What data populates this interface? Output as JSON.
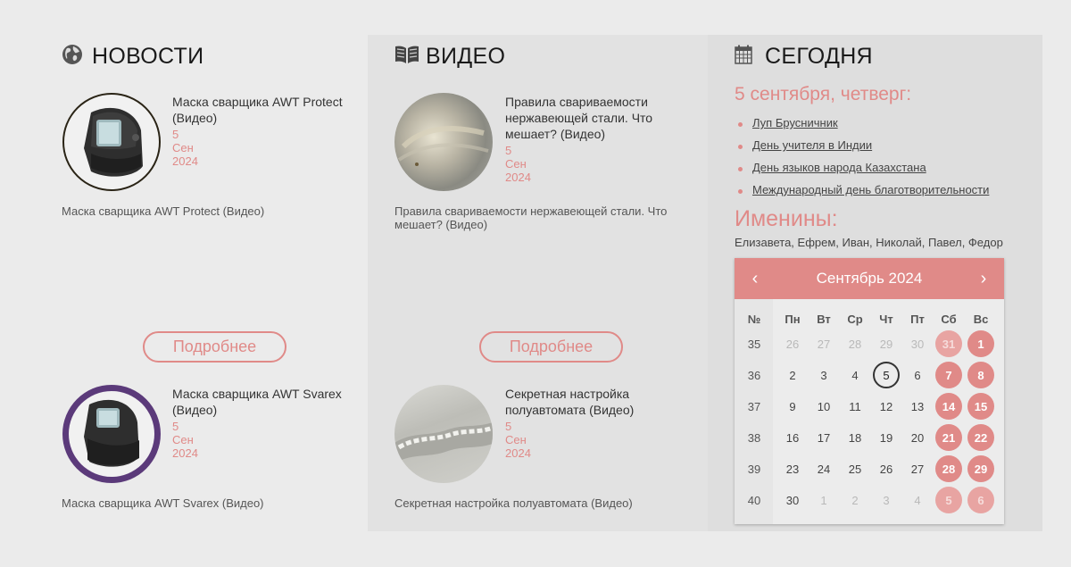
{
  "news": {
    "title": "НОВОСТИ",
    "icon": "globe-icon",
    "items": [
      {
        "title": "Маска сварщика AWT Protect (Видео)",
        "date": "5 Сен 2024",
        "desc": "Маска сварщика AWT Protect (Видео)"
      },
      {
        "title": "Маска сварщика AWT Svarex (Видео)",
        "date": "5 Сен 2024",
        "desc": "Маска сварщика AWT Svarex (Видео)"
      }
    ],
    "more_label": "Подробнее"
  },
  "video": {
    "title": "ВИДЕО",
    "icon": "book-icon",
    "items": [
      {
        "title": "Правила свариваемости нержавеющей стали. Что мешает? (Видео)",
        "date": "5 Сен 2024",
        "desc": "Правила свариваемости нержавеющей стали. Что мешает? (Видео)"
      },
      {
        "title": "Секретная настройка полуавтомата (Видео)",
        "date": "5 Сен 2024",
        "desc": "Секретная настройка полуавтомата (Видео)"
      }
    ],
    "more_label": "Подробнее"
  },
  "today": {
    "title": "СЕГОДНЯ",
    "icon": "calendar-icon",
    "date_text": "5 сентября, четверг:",
    "events": [
      "Луп Брусничник",
      "День учителя в Индии",
      "День языков народа Казахстана",
      "Международный день благотворительности"
    ],
    "namedays_title": "Именины:",
    "namedays": "Елизавета, Ефрем, Иван, Николай, Павел, Федор"
  },
  "calendar": {
    "month_label": "Сентябрь 2024",
    "prev": "‹",
    "next": "›",
    "week_header": "№",
    "weekdays": [
      "Пн",
      "Вт",
      "Ср",
      "Чт",
      "Пт",
      "Сб",
      "Вс"
    ],
    "weeks": [
      {
        "num": "35",
        "days": [
          {
            "d": "26",
            "m": true
          },
          {
            "d": "27",
            "m": true
          },
          {
            "d": "28",
            "m": true
          },
          {
            "d": "29",
            "m": true
          },
          {
            "d": "30",
            "m": true
          },
          {
            "d": "31",
            "m": true
          },
          {
            "d": "1",
            "m": false
          }
        ]
      },
      {
        "num": "36",
        "days": [
          {
            "d": "2",
            "m": false
          },
          {
            "d": "3",
            "m": false
          },
          {
            "d": "4",
            "m": false
          },
          {
            "d": "5",
            "m": false,
            "today": true
          },
          {
            "d": "6",
            "m": false
          },
          {
            "d": "7",
            "m": false
          },
          {
            "d": "8",
            "m": false
          }
        ]
      },
      {
        "num": "37",
        "days": [
          {
            "d": "9",
            "m": false
          },
          {
            "d": "10",
            "m": false
          },
          {
            "d": "11",
            "m": false
          },
          {
            "d": "12",
            "m": false
          },
          {
            "d": "13",
            "m": false
          },
          {
            "d": "14",
            "m": false
          },
          {
            "d": "15",
            "m": false
          }
        ]
      },
      {
        "num": "38",
        "days": [
          {
            "d": "16",
            "m": false
          },
          {
            "d": "17",
            "m": false
          },
          {
            "d": "18",
            "m": false
          },
          {
            "d": "19",
            "m": false
          },
          {
            "d": "20",
            "m": false
          },
          {
            "d": "21",
            "m": false
          },
          {
            "d": "22",
            "m": false
          }
        ]
      },
      {
        "num": "39",
        "days": [
          {
            "d": "23",
            "m": false
          },
          {
            "d": "24",
            "m": false
          },
          {
            "d": "25",
            "m": false
          },
          {
            "d": "26",
            "m": false
          },
          {
            "d": "27",
            "m": false
          },
          {
            "d": "28",
            "m": false
          },
          {
            "d": "29",
            "m": false
          }
        ]
      },
      {
        "num": "40",
        "days": [
          {
            "d": "30",
            "m": false
          },
          {
            "d": "1",
            "m": true
          },
          {
            "d": "2",
            "m": true
          },
          {
            "d": "3",
            "m": true
          },
          {
            "d": "4",
            "m": true
          },
          {
            "d": "5",
            "m": true
          },
          {
            "d": "6",
            "m": true
          }
        ]
      }
    ],
    "accent_color": "#e08a88"
  }
}
